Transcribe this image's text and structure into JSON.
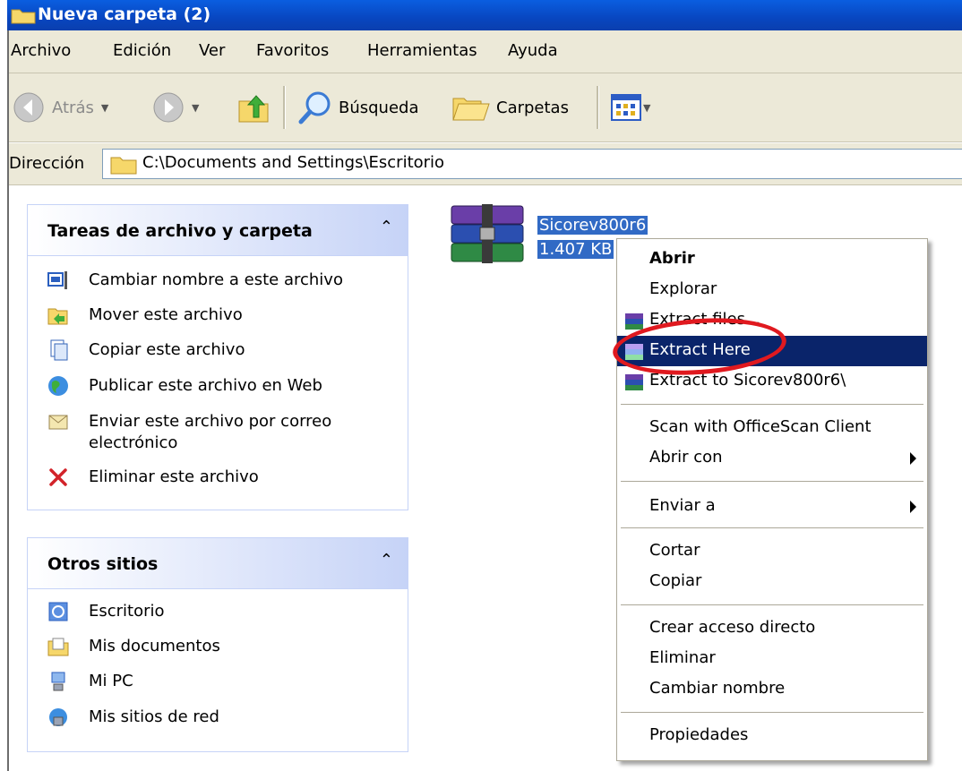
{
  "window": {
    "title": "Nueva carpeta (2)"
  },
  "menubar": {
    "items": [
      "Archivo",
      "Edición",
      "Ver",
      "Favoritos",
      "Herramientas",
      "Ayuda"
    ]
  },
  "toolbar": {
    "back_label": "Atrás",
    "search_label": "Búsqueda",
    "folders_label": "Carpetas"
  },
  "address": {
    "label": "Dirección",
    "path": "C:\\Documents and Settings\\Escritorio"
  },
  "file_tasks": {
    "title": "Tareas de archivo y carpeta",
    "items": [
      "Cambiar nombre a este archivo",
      "Mover este archivo",
      "Copiar este archivo",
      "Publicar este archivo en Web",
      "Enviar este archivo por correo",
      "electrónico",
      "Eliminar este archivo"
    ]
  },
  "other_places": {
    "title": "Otros sitios",
    "items": [
      "Escritorio",
      "Mis documentos",
      "Mi PC",
      "Mis sitios de red"
    ]
  },
  "file": {
    "name": "Sicorev800r6",
    "size": "1.407 KB"
  },
  "context_menu": {
    "items": [
      "Abrir",
      "Explorar",
      "Extract files...",
      "Extract Here",
      "Extract to Sicorev800r6\\",
      "Scan with OfficeScan Client",
      "Abrir con",
      "Enviar a",
      "Cortar",
      "Copiar",
      "Crear acceso directo",
      "Eliminar",
      "Cambiar nombre",
      "Propiedades"
    ],
    "highlighted": "Extract Here"
  },
  "colors": {
    "title_bar": "#0846c0",
    "highlight": "#0a246a",
    "annotation": "#e0191f",
    "panel_title": "#215dc6"
  }
}
